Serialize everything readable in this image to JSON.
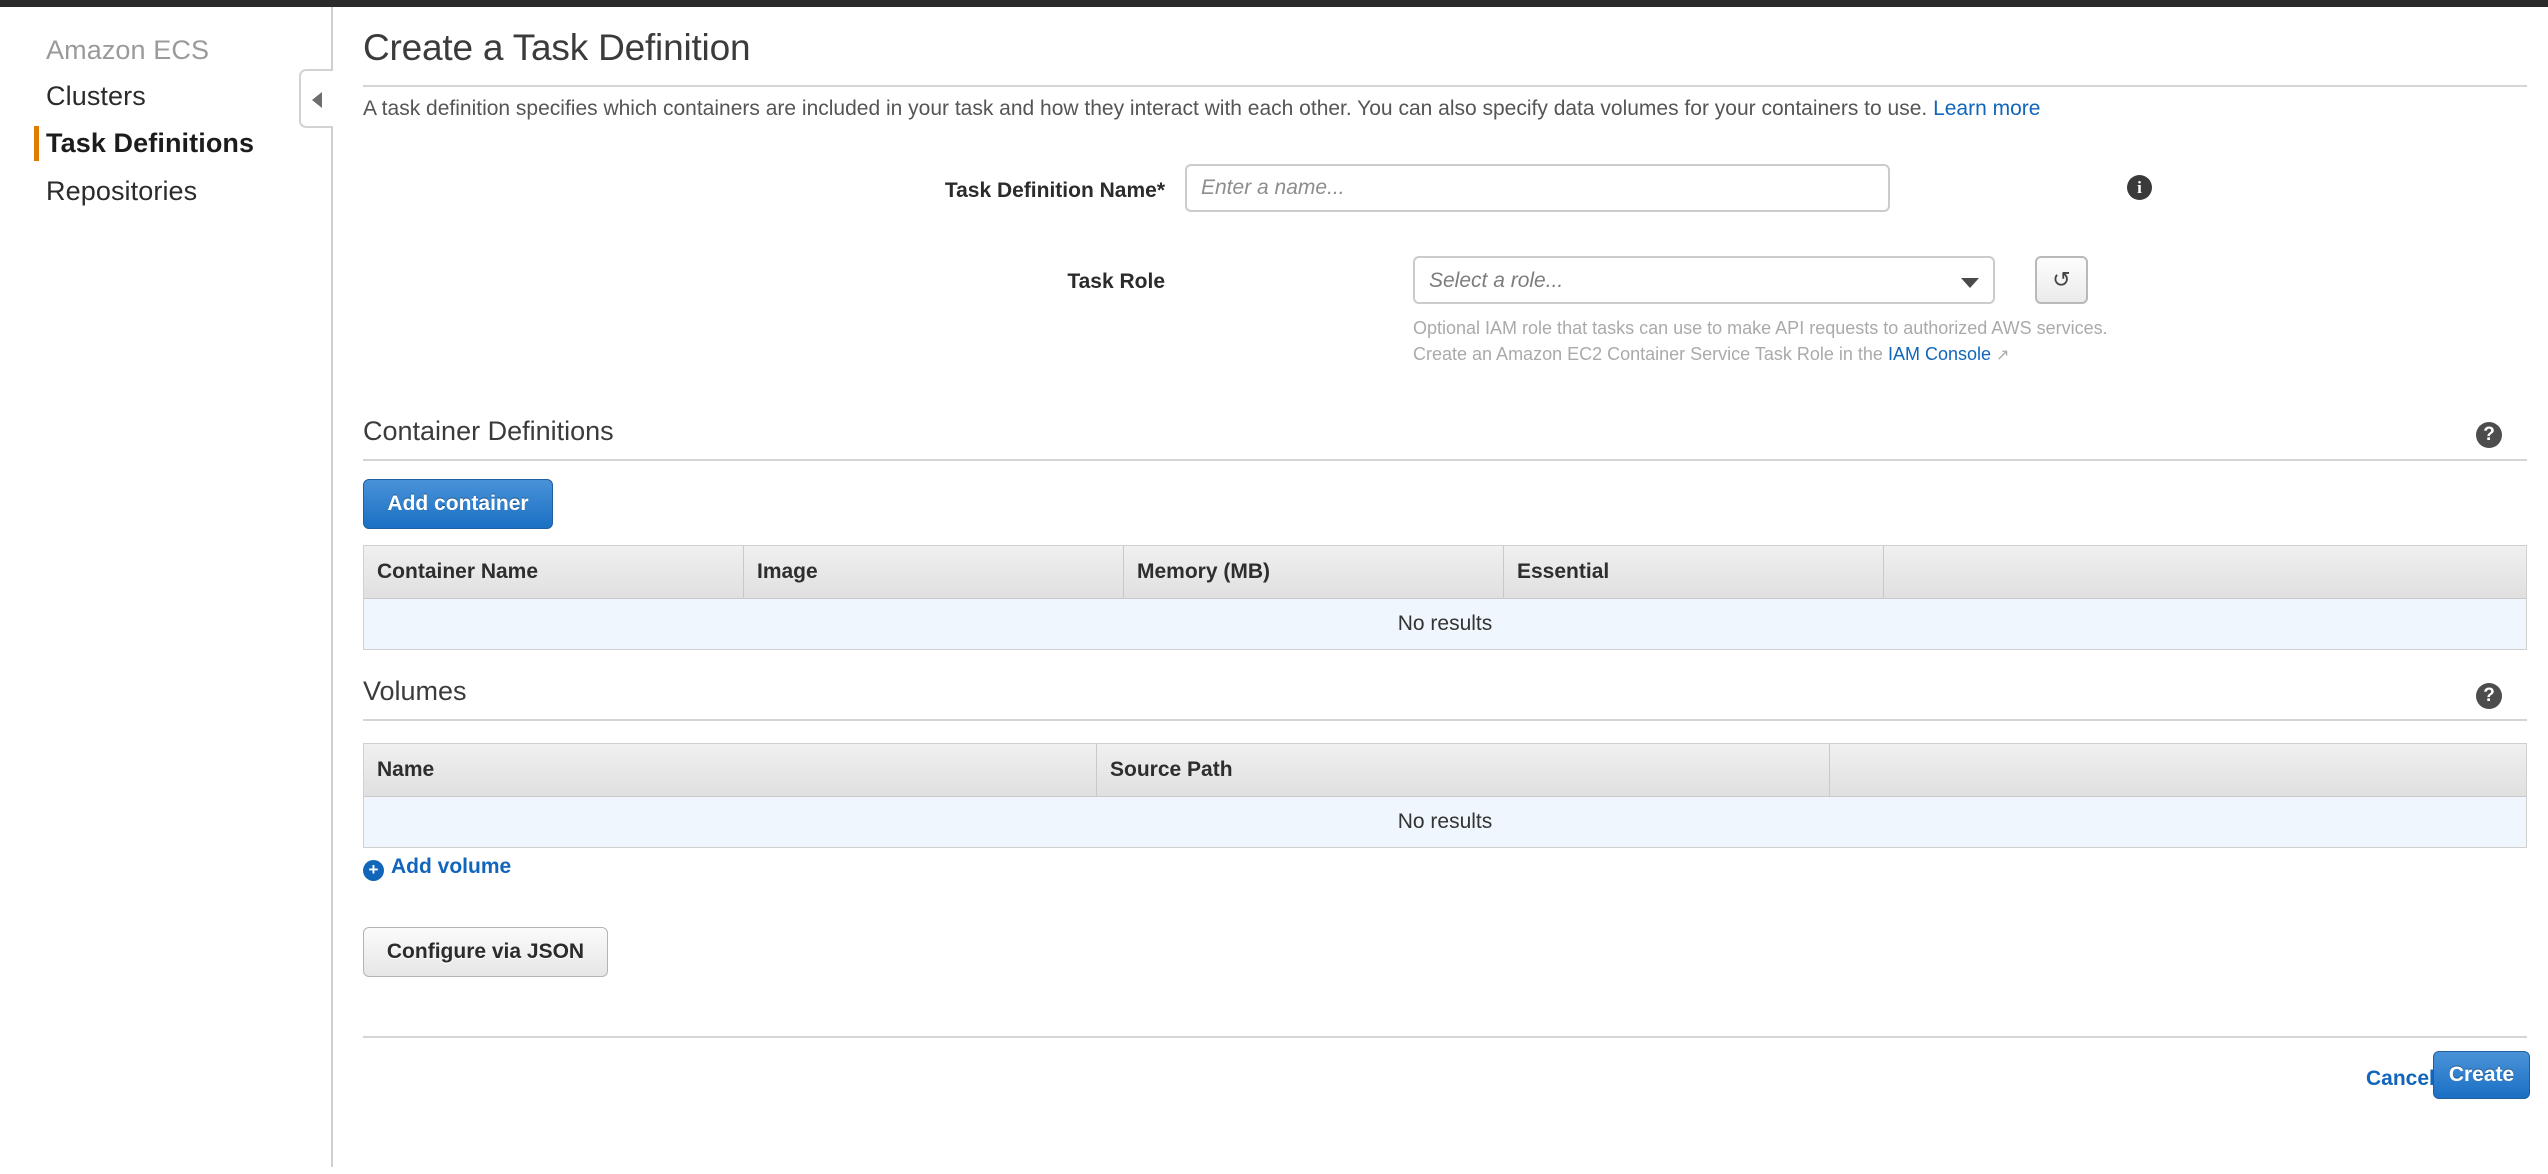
{
  "sidebar": {
    "title": "Amazon ECS",
    "items": [
      {
        "label": "Clusters",
        "active": false
      },
      {
        "label": "Task Definitions",
        "active": true
      },
      {
        "label": "Repositories",
        "active": false
      }
    ],
    "collapse_handle_icon": "chevron-left-icon"
  },
  "page": {
    "title": "Create a Task Definition",
    "description": "A task definition specifies which containers are included in your task and how they interact with each other. You can also specify data volumes for your containers to use.",
    "learn_more_label": "Learn more"
  },
  "form": {
    "task_definition_name": {
      "label": "Task Definition Name*",
      "value": "",
      "placeholder": "Enter a name...",
      "info_icon": "info-icon"
    },
    "task_role": {
      "label": "Task Role",
      "selected": "Select a role...",
      "refresh_icon": "refresh-icon",
      "hint_line_1": "Optional IAM role that tasks can use to make API requests to authorized AWS services.",
      "hint_line_2_prefix": "Create an Amazon EC2 Container Service Task Role in the",
      "hint_link_label": "IAM Console",
      "external_link_icon": "external-link-icon"
    }
  },
  "container_definitions": {
    "title": "Container Definitions",
    "help_icon": "question-circle-icon",
    "add_button_label": "Add container",
    "columns": [
      "Container Name",
      "Image",
      "Memory (MB)",
      "Essential",
      ""
    ],
    "rows": [],
    "empty_text": "No results"
  },
  "volumes": {
    "title": "Volumes",
    "help_icon": "question-circle-icon",
    "columns": [
      "Name",
      "Source Path",
      ""
    ],
    "rows": [],
    "empty_text": "No results",
    "add_volume_label": "Add volume",
    "add_volume_icon": "plus-circle-icon"
  },
  "actions": {
    "configure_json_label": "Configure via JSON",
    "cancel_label": "Cancel",
    "create_label": "Create"
  },
  "colors": {
    "accent_orange": "#e07b00",
    "link_blue": "#1166bb",
    "primary_button": "#1a70c4",
    "empty_row_bg": "#eff6fd",
    "top_strip": "#2b2b2b"
  }
}
